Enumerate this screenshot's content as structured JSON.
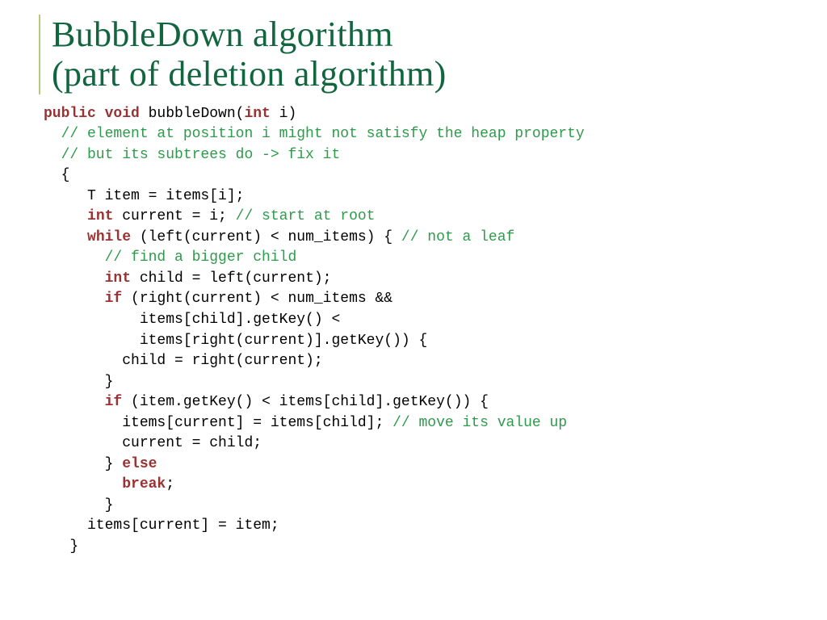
{
  "title_line1": "BubbleDown algorithm",
  "title_line2": "(part of deletion algorithm)",
  "code": {
    "l01_kw1": "public void",
    "l01_rest": " bubbleDown(",
    "l01_kw2": "int",
    "l01_rest2": " i)",
    "l02_cm": "  // element at position i might not satisfy the heap property",
    "l03_cm": "  // but its subtrees do -> fix it",
    "l04": "  {",
    "l05": "     T item = items[i];",
    "l06_pad": "     ",
    "l06_kw": "int",
    "l06_rest": " current = i; ",
    "l06_cm": "// start at root",
    "l07_pad": "     ",
    "l07_kw": "while",
    "l07_rest": " (left(current) < num_items) { ",
    "l07_cm": "// not a leaf",
    "l08_cm": "       // find a bigger child",
    "l09_pad": "       ",
    "l09_kw": "int",
    "l09_rest": " child = left(current);",
    "l10_pad": "       ",
    "l10_kw": "if",
    "l10_rest": " (right(current) < num_items &&",
    "l11": "           items[child].getKey() <",
    "l12": "           items[right(current)].getKey()) {",
    "l13": "         child = right(current);",
    "l14": "       }",
    "l15_pad": "       ",
    "l15_kw": "if",
    "l15_rest": " (item.getKey() < items[child].getKey()) {",
    "l16": "         items[current] = items[child]; ",
    "l16_cm": "// move its value up",
    "l17": "         current = child;",
    "l18_pad": "       } ",
    "l18_kw": "else",
    "l19_pad": "         ",
    "l19_kw": "break",
    "l19_rest": ";",
    "l20": "       }",
    "l21": "     items[current] = item;",
    "l22": "   }"
  }
}
